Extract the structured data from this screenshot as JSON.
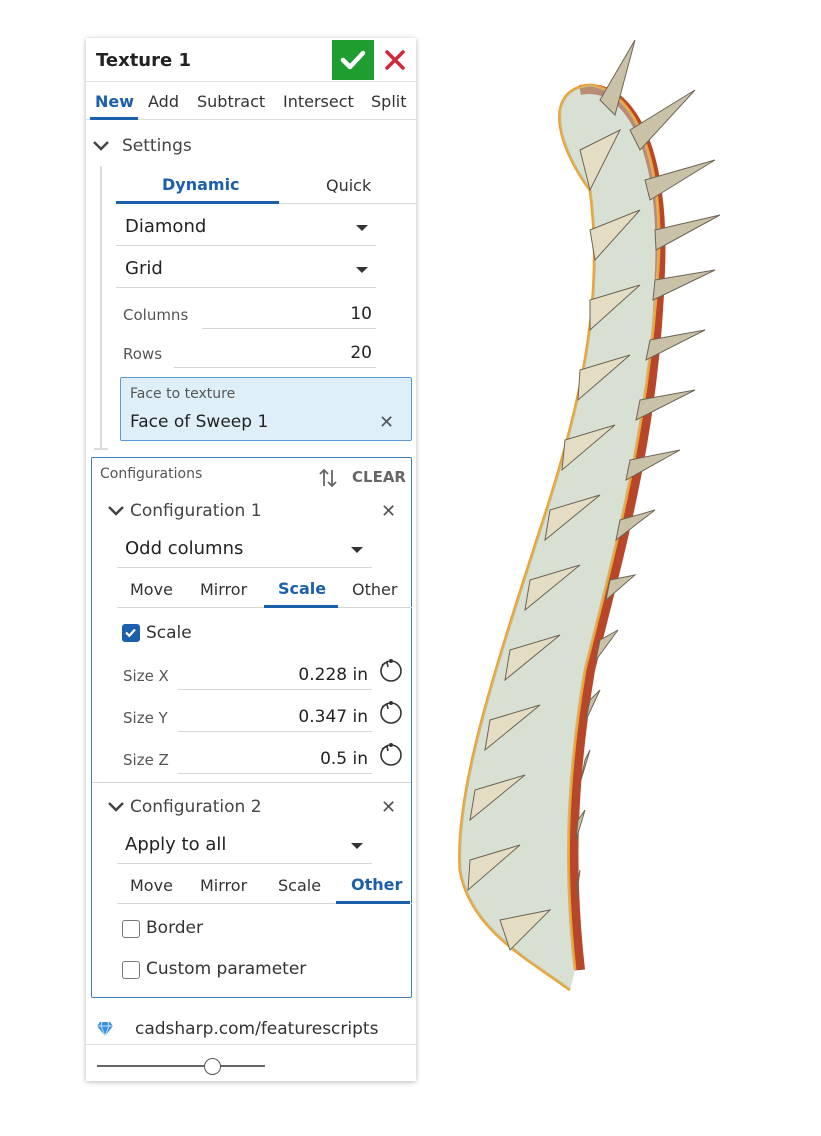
{
  "header": {
    "title": "Texture 1"
  },
  "top_tabs": [
    "New",
    "Add",
    "Subtract",
    "Intersect",
    "Split"
  ],
  "settings": {
    "title": "Settings",
    "mode_tabs": [
      "Dynamic",
      "Quick"
    ],
    "pattern": "Diamond",
    "layout": "Grid",
    "columns_label": "Columns",
    "columns_value": "10",
    "rows_label": "Rows",
    "rows_value": "20",
    "face_label": "Face to texture",
    "face_value": "Face of Sweep 1"
  },
  "configurations": {
    "title": "Configurations",
    "clear_label": "CLEAR",
    "config1": {
      "title": "Configuration 1",
      "selection": "Odd columns",
      "tabs": [
        "Move",
        "Mirror",
        "Scale",
        "Other"
      ],
      "scale_label": "Scale",
      "scale_checked": true,
      "size_x_label": "Size X",
      "size_x_value": "0.228 in",
      "size_y_label": "Size Y",
      "size_y_value": "0.347 in",
      "size_z_label": "Size Z",
      "size_z_value": "0.5 in"
    },
    "config2": {
      "title": "Configuration 2",
      "selection": "Apply to all",
      "tabs": [
        "Move",
        "Mirror",
        "Scale",
        "Other"
      ],
      "border_label": "Border",
      "custom_label": "Custom parameter"
    }
  },
  "footer": {
    "link": "cadsharp.com/featurescripts"
  },
  "colors": {
    "accent": "#1c5fab",
    "ok": "#1f9d2f",
    "cancel": "#d0283a",
    "face_bg": "#deeffa"
  },
  "icons": [
    "checkmark-icon",
    "close-icon",
    "chevron-down-icon",
    "caret-down-icon",
    "sort-icon",
    "parameter-icon",
    "gem-icon"
  ]
}
